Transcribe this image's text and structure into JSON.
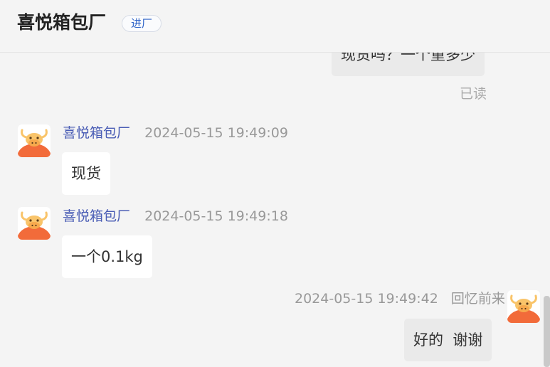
{
  "header": {
    "title": "喜悦箱包厂",
    "badge": "进厂"
  },
  "messages": [
    {
      "direction": "out",
      "text": "现货吗？一个重多少",
      "status": "已读"
    },
    {
      "direction": "in",
      "sender": "喜悦箱包厂",
      "time": "2024-05-15 19:49:09",
      "text": "现货"
    },
    {
      "direction": "in",
      "sender": "喜悦箱包厂",
      "time": "2024-05-15 19:49:18",
      "text": "一个0.1kg"
    },
    {
      "direction": "out",
      "sender": "回忆前来",
      "time": "2024-05-15 19:49:42",
      "text": "好的  谢谢"
    }
  ],
  "colors": {
    "background": "#f4f4f4",
    "incoming_bubble": "#ffffff",
    "outgoing_bubble": "#eaeaea",
    "sender_name": "#4a5db5",
    "badge_text": "#2f64c8",
    "avatar_body": "#f26b3a",
    "avatar_face": "#f9c46a"
  },
  "icons": {
    "avatar": "cartoon-bull-avatar"
  }
}
